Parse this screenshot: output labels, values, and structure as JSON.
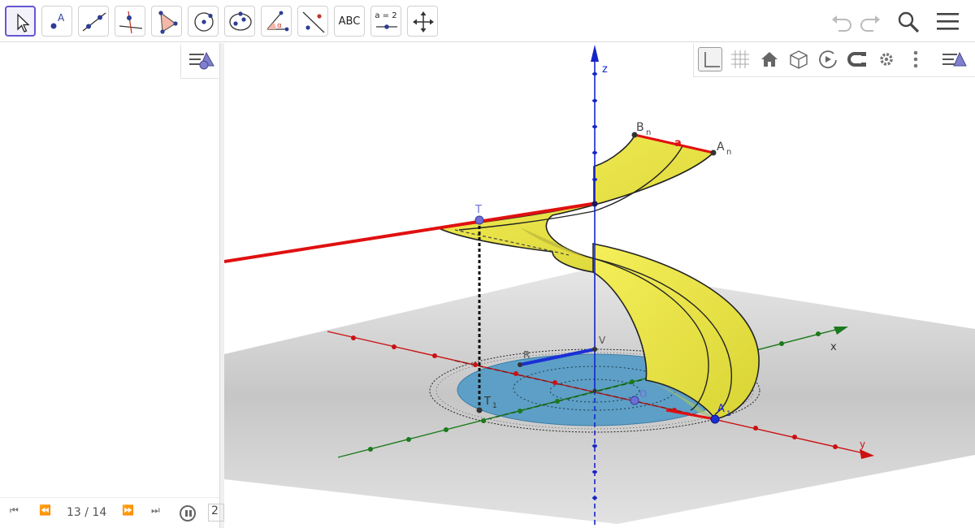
{
  "toolbar": {
    "text_tool_label": "ABC",
    "slider_tool_label": "a = 2",
    "tools": [
      "move-tool",
      "point-tool",
      "line-tool",
      "perpendicular-line-tool",
      "polygon-tool",
      "circle-tool",
      "conic-tool",
      "angle-tool",
      "reflect-tool",
      "text-tool",
      "slider-tool",
      "move-view-tool"
    ],
    "right": [
      "undo-icon",
      "redo-icon",
      "search-icon",
      "menu-icon"
    ]
  },
  "player": {
    "counter": "13 / 14",
    "speed": "2"
  },
  "graphics_toolbar": [
    "axes-icon",
    "grid-icon",
    "home-icon",
    "cube-icon",
    "rotate-icon",
    "projection-icon",
    "gear-icon",
    "more-icon",
    "style-bar-icon"
  ],
  "labels": {
    "axis_x": "x",
    "axis_y": "y",
    "axis_z": "z",
    "point_b": "B",
    "point_b_sub": "n",
    "point_a": "A",
    "point_a_sub": "n",
    "segment_a": "a",
    "point_t": "T",
    "point_t1": "T",
    "point_t1_sub": "1",
    "point_r": "R",
    "point_v": "V",
    "point_o": "O",
    "point_a1": "A",
    "point_a1_sub": "1"
  },
  "colors": {
    "accent": "#6557d2",
    "x_axis": "#cc1111",
    "y_axis": "#1b7a1b",
    "z_axis": "#1525c8",
    "surface": "#e8e33c",
    "disk": "#5d9fc6",
    "plane": "#c7c7c7",
    "red_line": "#e01010"
  }
}
